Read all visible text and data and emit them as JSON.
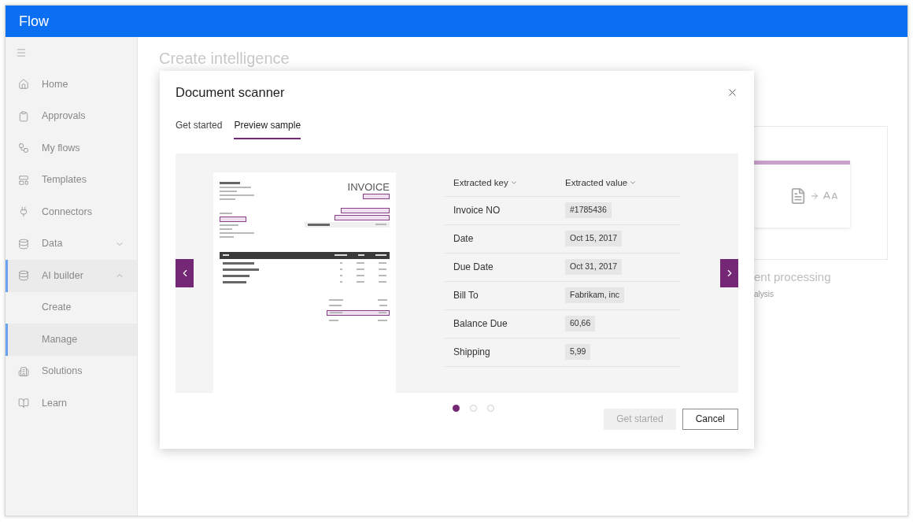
{
  "app_bar": {
    "title": "Flow"
  },
  "sidebar": {
    "items": [
      {
        "label": "Home",
        "selected": false
      },
      {
        "label": "Approvals",
        "selected": false
      },
      {
        "label": "My flows",
        "selected": false
      },
      {
        "label": "Templates",
        "selected": false
      },
      {
        "label": "Connectors",
        "selected": false
      },
      {
        "label": "Data",
        "selected": false,
        "expanded": false
      },
      {
        "label": "AI builder",
        "selected": true,
        "expanded": true,
        "children": [
          {
            "label": "Create",
            "selected": false
          },
          {
            "label": "Manage",
            "selected": true
          }
        ]
      },
      {
        "label": "Solutions",
        "selected": false
      },
      {
        "label": "Learn",
        "selected": false
      }
    ]
  },
  "page": {
    "heading": "Create intelligence",
    "card": {
      "title": "ent processing",
      "subtitle": "alysis"
    }
  },
  "dialog": {
    "title": "Document scanner",
    "tabs": [
      {
        "label": "Get started",
        "selected": false
      },
      {
        "label": "Preview sample",
        "selected": true
      }
    ],
    "invoice": {
      "title": "INVOICE"
    },
    "table": {
      "columns": [
        "Extracted key",
        "Extracted value"
      ],
      "rows": [
        {
          "key": "Invoice NO",
          "value": "#1785436"
        },
        {
          "key": "Date",
          "value": "Oct 15, 2017"
        },
        {
          "key": "Due Date",
          "value": "Oct 31, 2017"
        },
        {
          "key": "Bill To",
          "value": "Fabrikam, inc"
        },
        {
          "key": "Balance Due",
          "value": "60,66"
        },
        {
          "key": "Shipping",
          "value": "5,99"
        }
      ]
    },
    "pager": [
      {
        "selected": true
      },
      {
        "selected": false
      },
      {
        "selected": false
      }
    ],
    "buttons": [
      {
        "label": "Get started",
        "disabled": true
      },
      {
        "label": "Cancel",
        "disabled": false
      }
    ]
  }
}
